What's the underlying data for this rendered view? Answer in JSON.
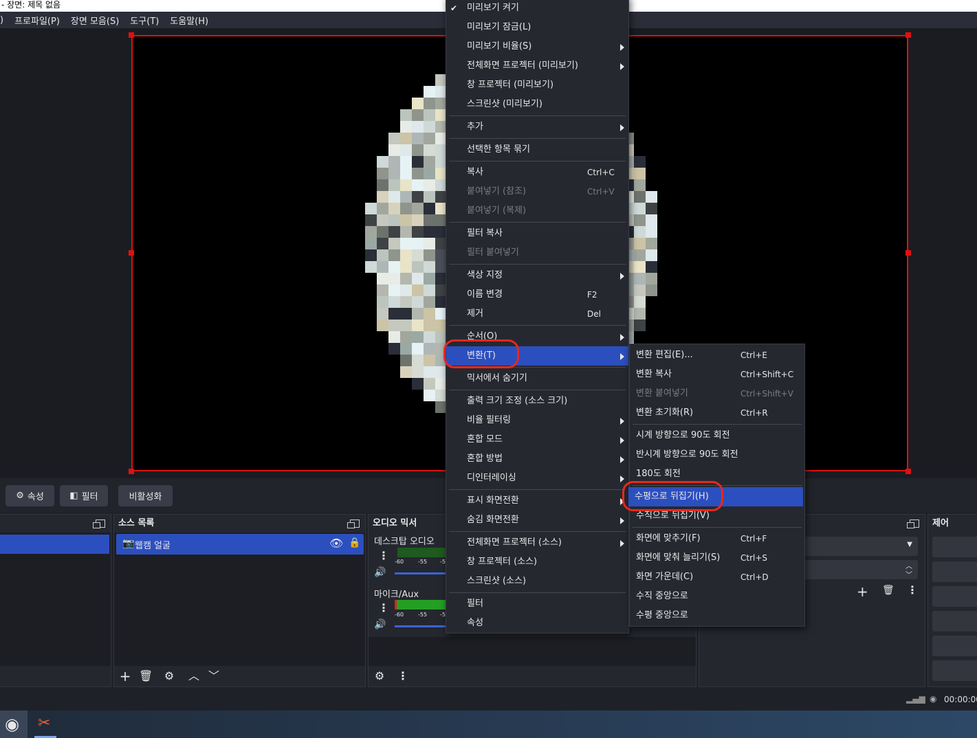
{
  "window": {
    "title": "- 장면: 제목 없음"
  },
  "menubar": {
    "items": [
      ")",
      "프로파일(P)",
      "장면 모음(S)",
      "도구(T)",
      "도움말(H)"
    ]
  },
  "toolbar": {
    "properties": "속성",
    "filters": "필터",
    "deactivate": "비활성화"
  },
  "docks": {
    "sources_title": "소스 목록",
    "source_item": "웹캠 얼굴",
    "mixer_title": "오디오 믹서",
    "desktop_audio": "데스크탑 오디오",
    "mic_aux": "마이크/Aux",
    "meter_ticks": [
      "-60",
      "-55",
      "-5"
    ],
    "controls_title": "제어"
  },
  "status": {
    "time": "00:00:00"
  },
  "context_menu": {
    "items": [
      {
        "label": "미리보기 켜기",
        "checked": true
      },
      {
        "label": "미리보기 잠금(L)"
      },
      {
        "label": "미리보기 비율(S)",
        "submenu": true
      },
      {
        "label": "전체화면 프로젝터 (미리보기)",
        "submenu": true
      },
      {
        "label": "창 프로젝터 (미리보기)"
      },
      {
        "label": "스크린샷 (미리보기)"
      },
      {
        "label": "추가",
        "submenu": true
      },
      {
        "label": "선택한 항목 묶기"
      },
      {
        "label": "복사",
        "shortcut": "Ctrl+C"
      },
      {
        "label": "붙여넣기 (참조)",
        "shortcut": "Ctrl+V",
        "disabled": true
      },
      {
        "label": "붙여넣기 (복제)",
        "disabled": true
      },
      {
        "label": "필터 복사"
      },
      {
        "label": "필터 붙여넣기",
        "disabled": true
      },
      {
        "label": "색상 지정",
        "submenu": true
      },
      {
        "label": "이름 변경",
        "shortcut": "F2"
      },
      {
        "label": "제거",
        "shortcut": "Del"
      },
      {
        "label": "순서(O)",
        "submenu": true
      },
      {
        "label": "변환(T)",
        "submenu": true,
        "highlighted": true
      },
      {
        "label": "믹서에서 숨기기"
      },
      {
        "label": "출력 크기 조정 (소스 크기)"
      },
      {
        "label": "비율 필터링",
        "submenu": true
      },
      {
        "label": "혼합 모드",
        "submenu": true
      },
      {
        "label": "혼합 방법",
        "submenu": true
      },
      {
        "label": "디인터레이싱",
        "submenu": true
      },
      {
        "label": "표시 화면전환",
        "submenu": true
      },
      {
        "label": "숨김 화면전환",
        "submenu": true
      },
      {
        "label": "전체화면 프로젝터 (소스)",
        "submenu": true
      },
      {
        "label": "창 프로젝터 (소스)"
      },
      {
        "label": "스크린샷 (소스)"
      },
      {
        "label": "필터"
      },
      {
        "label": "속성"
      }
    ]
  },
  "transform_menu": {
    "items": [
      {
        "label": "변환 편집(E)...",
        "shortcut": "Ctrl+E"
      },
      {
        "label": "변환 복사",
        "shortcut": "Ctrl+Shift+C"
      },
      {
        "label": "변환 붙여넣기",
        "shortcut": "Ctrl+Shift+V",
        "disabled": true
      },
      {
        "label": "변환 초기화(R)",
        "shortcut": "Ctrl+R"
      },
      {
        "label": "시계 방향으로 90도 회전"
      },
      {
        "label": "반시계 방향으로 90도 회전"
      },
      {
        "label": "180도 회전"
      },
      {
        "label": "수평으로 뒤집기(H)",
        "highlighted": true
      },
      {
        "label": "수직으로 뒤집기(V)"
      },
      {
        "label": "화면에 맞추기(F)",
        "shortcut": "Ctrl+F"
      },
      {
        "label": "화면에 맞춰 늘리기(S)",
        "shortcut": "Ctrl+S"
      },
      {
        "label": "화면 가운데(C)",
        "shortcut": "Ctrl+D"
      },
      {
        "label": "수직 중앙으로"
      },
      {
        "label": "수평 중앙으로"
      }
    ]
  },
  "colors": {
    "accent": "#2c4fbf",
    "selection_border": "#e01010",
    "annotation": "#e8281e"
  }
}
